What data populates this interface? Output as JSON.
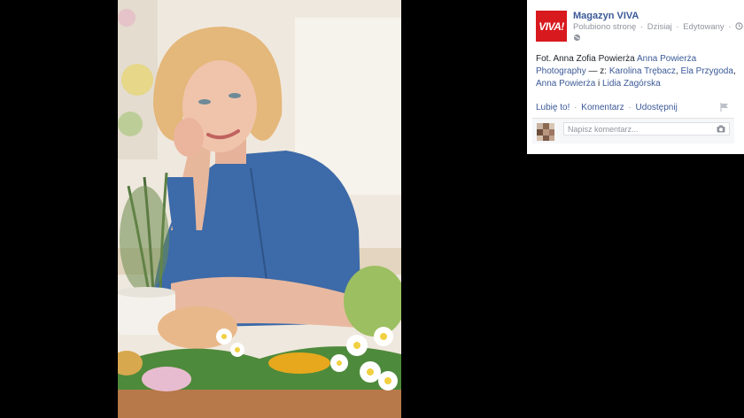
{
  "post": {
    "page_name": "Magazyn VIVA",
    "logo_text": "VIVA!",
    "meta": [
      "Polubiono stronę",
      "·",
      "Dzisiaj",
      "·",
      "Edytowany",
      "·"
    ],
    "caption_prefix": "Fot. Anna Zofia Powierża",
    "caption_link": "Anna Powierża Photography",
    "caption_with": " — z: ",
    "tagged": [
      "Karolina Trębacz",
      "Ela Przygoda",
      "Anna Powierża",
      "Lidia Zagórska"
    ],
    "sep_comma": ", ",
    "sep_and": " i "
  },
  "actions": {
    "like": "Lubię to!",
    "comment": "Komentarz",
    "share": "Udostępnij",
    "dot": "·"
  },
  "comment_box": {
    "placeholder": "Napisz komentarz..."
  },
  "colors": {
    "brand": "#d8191e",
    "link": "#3b5998",
    "muted": "#90949c"
  },
  "icons": [
    "clock-icon",
    "globe-icon",
    "flag-icon",
    "camera-icon"
  ]
}
